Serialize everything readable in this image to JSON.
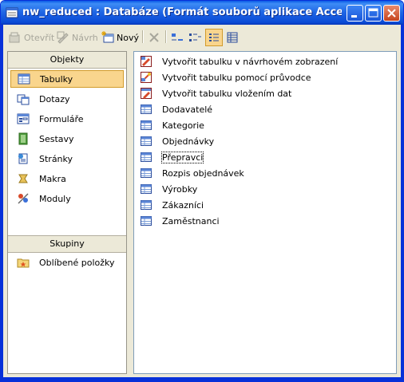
{
  "window": {
    "title": "nw_reduced : Databáze (Formát souborů aplikace Access 200...",
    "buttons": {
      "minimize": "minimize-icon",
      "maximize": "maximize-icon",
      "close": "close-icon"
    }
  },
  "toolbar": {
    "open_label": "Otevřít",
    "design_label": "Návrh",
    "new_label": "Nový"
  },
  "objects_pane": {
    "header": "Objekty",
    "items": [
      {
        "label": "Tabulky",
        "icon": "table-icon",
        "selected": true
      },
      {
        "label": "Dotazy",
        "icon": "query-icon"
      },
      {
        "label": "Formuláře",
        "icon": "form-icon"
      },
      {
        "label": "Sestavy",
        "icon": "report-icon"
      },
      {
        "label": "Stránky",
        "icon": "page-icon"
      },
      {
        "label": "Makra",
        "icon": "macro-icon"
      },
      {
        "label": "Moduly",
        "icon": "module-icon"
      }
    ]
  },
  "groups_pane": {
    "header": "Skupiny",
    "items": [
      {
        "label": "Oblíbené položky",
        "icon": "favorites-folder-icon"
      }
    ]
  },
  "list": {
    "items": [
      {
        "label": "Vytvořit tabulku v návrhovém zobrazení",
        "icon": "create-table-design-icon"
      },
      {
        "label": "Vytvořit tabulku pomocí průvodce",
        "icon": "create-table-wizard-icon"
      },
      {
        "label": "Vytvořit tabulku vložením dat",
        "icon": "create-table-data-icon"
      },
      {
        "label": "Dodavatelé",
        "icon": "table-icon"
      },
      {
        "label": "Kategorie",
        "icon": "table-icon"
      },
      {
        "label": "Objednávky",
        "icon": "table-icon"
      },
      {
        "label": "Přepravci",
        "icon": "table-icon",
        "focused": true
      },
      {
        "label": "Rozpis objednávek",
        "icon": "table-icon"
      },
      {
        "label": "Výrobky",
        "icon": "table-icon"
      },
      {
        "label": "Zákazníci",
        "icon": "table-icon"
      },
      {
        "label": "Zaměstnanci",
        "icon": "table-icon"
      }
    ]
  },
  "colors": {
    "title_bar": "#0a5ae6",
    "selection": "#f9d58d",
    "selection_border": "#d29b2b",
    "chrome": "#ece9d8"
  }
}
